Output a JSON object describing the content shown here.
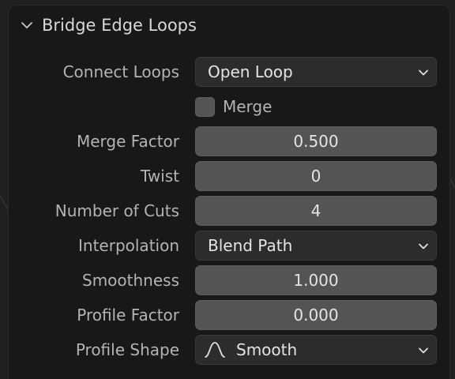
{
  "panel": {
    "title": "Bridge Edge Loops",
    "expanded": true
  },
  "connect_loops": {
    "label": "Connect Loops",
    "value": "Open Loop"
  },
  "merge": {
    "label": "Merge",
    "checked": false
  },
  "merge_factor": {
    "label": "Merge Factor",
    "value": "0.500"
  },
  "twist": {
    "label": "Twist",
    "value": "0"
  },
  "number_of_cuts": {
    "label": "Number of Cuts",
    "value": "4"
  },
  "interpolation": {
    "label": "Interpolation",
    "value": "Blend Path"
  },
  "smoothness": {
    "label": "Smoothness",
    "value": "1.000"
  },
  "profile_factor": {
    "label": "Profile Factor",
    "value": "0.000"
  },
  "profile_shape": {
    "label": "Profile Shape",
    "value": "Smooth",
    "icon": "smooth-falloff-icon"
  },
  "colors": {
    "background": "#202020",
    "panel": "#181818",
    "field": "#545454",
    "dropdown": "#2c2c2c",
    "label_text": "#b4b4b4",
    "value_text": "#e4e4e4"
  }
}
